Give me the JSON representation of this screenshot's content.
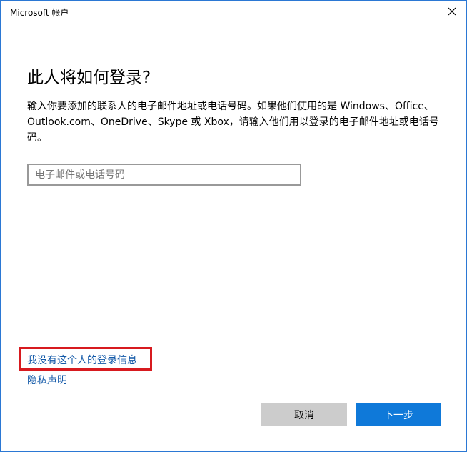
{
  "window": {
    "title": "Microsoft 帐户"
  },
  "main": {
    "heading": "此人将如何登录?",
    "description": "输入你要添加的联系人的电子邮件地址或电话号码。如果他们使用的是 Windows、Office、Outlook.com、OneDrive、Skype 或 Xbox，请输入他们用以登录的电子邮件地址或电话号码。",
    "input": {
      "value": "",
      "placeholder": "电子邮件或电话号码"
    }
  },
  "links": {
    "no_login_info": "我没有这个人的登录信息",
    "privacy": "隐私声明"
  },
  "buttons": {
    "cancel": "取消",
    "next": "下一步"
  },
  "colors": {
    "accent": "#0f79d9",
    "link": "#1359a8",
    "highlight_border": "#d71a1f",
    "window_border": "#2b78d4"
  },
  "icons": {
    "close": "close-icon"
  }
}
